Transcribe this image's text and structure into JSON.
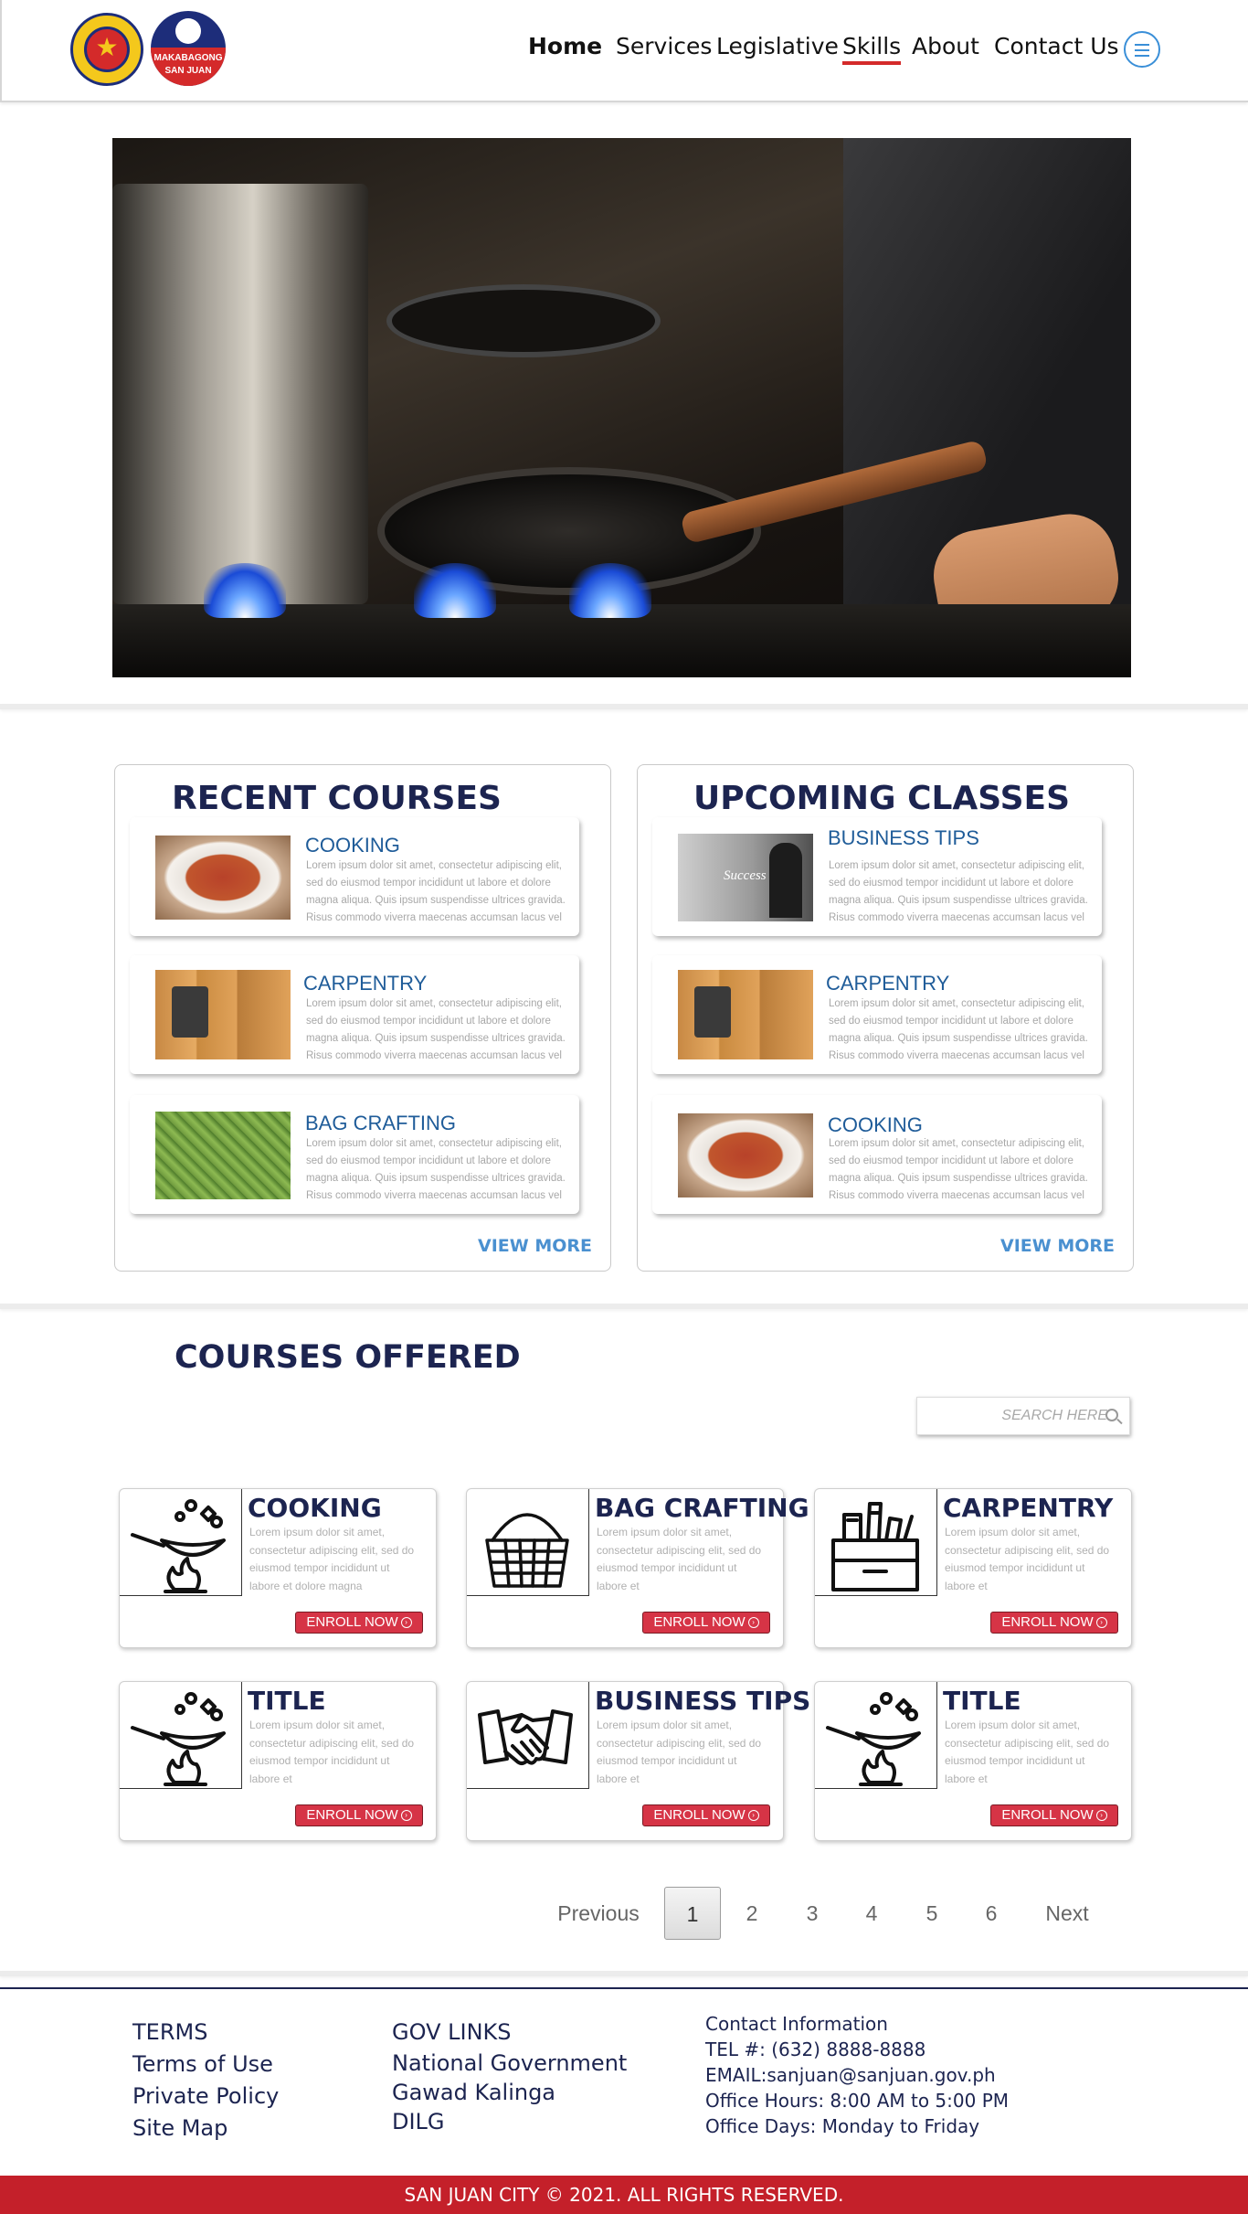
{
  "header": {
    "logo1_alt": "",
    "logo2_text": [
      "MAKABAGONG",
      "SAN JUAN"
    ],
    "nav": [
      {
        "label": "Home"
      },
      {
        "label": "Services"
      },
      {
        "label": "Legislative"
      },
      {
        "label": "Skills"
      },
      {
        "label": "About"
      },
      {
        "label": "Contact Us"
      }
    ],
    "menu_icon": "hamburger-circle-icon"
  },
  "hero": {
    "image": "cooking-stove-photo"
  },
  "recent": {
    "title": "RECENT COURSES",
    "view_more": "VIEW MORE",
    "items": [
      {
        "title": "COOKING",
        "desc": "Lorem ipsum dolor sit amet, consectetur adipiscing elit, sed do eiusmod tempor incididunt ut labore et dolore magna aliqua. Quis ipsum suspendisse ultrices gravida. Risus commodo viverra maecenas accumsan lacus vel"
      },
      {
        "title": "CARPENTRY",
        "desc": "Lorem ipsum dolor sit amet, consectetur adipiscing elit, sed do eiusmod tempor incididunt ut labore et dolore magna aliqua. Quis ipsum suspendisse ultrices gravida. Risus commodo viverra maecenas accumsan lacus vel"
      },
      {
        "title": "BAG CRAFTING",
        "desc": "Lorem ipsum dolor sit amet, consectetur adipiscing elit, sed do eiusmod tempor incididunt ut labore et dolore magna aliqua. Quis ipsum suspendisse ultrices gravida. Risus commodo viverra maecenas accumsan lacus vel"
      }
    ]
  },
  "upcoming": {
    "title": "UPCOMING CLASSES",
    "view_more": "VIEW MORE",
    "items": [
      {
        "title": "BUSINESS TIPS",
        "desc": "Lorem ipsum dolor sit amet, consectetur adipiscing elit, sed do eiusmod tempor incididunt ut labore et dolore magna aliqua. Quis ipsum suspendisse ultrices gravida. Risus commodo viverra maecenas accumsan lacus vel",
        "thumb_text": "Success"
      },
      {
        "title": "CARPENTRY",
        "desc": "Lorem ipsum dolor sit amet, consectetur adipiscing elit, sed do eiusmod tempor incididunt ut labore et dolore magna aliqua. Quis ipsum suspendisse ultrices gravida. Risus commodo viverra maecenas accumsan lacus vel"
      },
      {
        "title": "COOKING",
        "desc": "Lorem ipsum dolor sit amet, consectetur adipiscing elit, sed do eiusmod tempor incididunt ut labore et dolore magna aliqua. Quis ipsum suspendisse ultrices gravida. Risus commodo viverra maecenas accumsan lacus vel"
      }
    ]
  },
  "offered": {
    "title": "COURSES OFFERED",
    "search_placeholder": "SEARCH HERE",
    "enroll_label": "ENROLL NOW",
    "cards": [
      {
        "title": "COOKING",
        "icon": "cooking-pan-fire-icon",
        "desc": "Lorem ipsum dolor sit amet, consectetur adipiscing elit, sed do eiusmod tempor incididunt ut labore et dolore magna"
      },
      {
        "title": "BAG CRAFTING",
        "icon": "basket-icon",
        "desc": "Lorem ipsum dolor sit amet, consectetur adipiscing elit, sed do eiusmod tempor incididunt ut labore et"
      },
      {
        "title": "CARPENTRY",
        "icon": "toolbox-icon",
        "desc": "Lorem ipsum dolor sit amet, consectetur adipiscing elit, sed do eiusmod tempor incididunt ut labore et"
      },
      {
        "title": "TITLE",
        "icon": "cooking-pan-fire-icon",
        "desc": "Lorem ipsum dolor sit amet, consectetur adipiscing elit, sed do eiusmod tempor incididunt ut labore et"
      },
      {
        "title": "BUSINESS TIPS",
        "icon": "handshake-icon",
        "desc": "Lorem ipsum dolor sit amet, consectetur adipiscing elit, sed do eiusmod tempor incididunt ut labore et"
      },
      {
        "title": "TITLE",
        "icon": "cooking-pan-fire-icon",
        "desc": "Lorem ipsum dolor sit amet, consectetur adipiscing elit, sed do eiusmod tempor incididunt ut labore et"
      }
    ]
  },
  "pagination": {
    "previous": "Previous",
    "pages": [
      "1",
      "2",
      "3",
      "4",
      "5",
      "6"
    ],
    "current": "1",
    "next": "Next"
  },
  "footer": {
    "col1": {
      "heading": "TERMS",
      "items": [
        "Terms of Use",
        "Private Policy",
        "Site Map"
      ]
    },
    "col2": {
      "heading": "GOV LINKS",
      "items": [
        "National Government",
        "Gawad Kalinga",
        "DILG"
      ]
    },
    "col3": {
      "heading": "Contact Information",
      "items": [
        "TEL #:  (632) 8888-8888",
        "EMAIL:sanjuan@sanjuan.gov.ph",
        "Office Hours: 8:00 AM to 5:00 PM",
        "Office Days: Monday to Friday"
      ]
    },
    "copyright": "SAN JUAN CITY © 2021. ALL RIGHTS RESERVED."
  },
  "colors": {
    "navy": "#1c2450",
    "accent_red": "#d42a2a",
    "link_blue": "#1f5c99",
    "view_more_blue": "#4a90d0",
    "enroll_red": "#d63446",
    "footer_bar": "#c4202a"
  }
}
